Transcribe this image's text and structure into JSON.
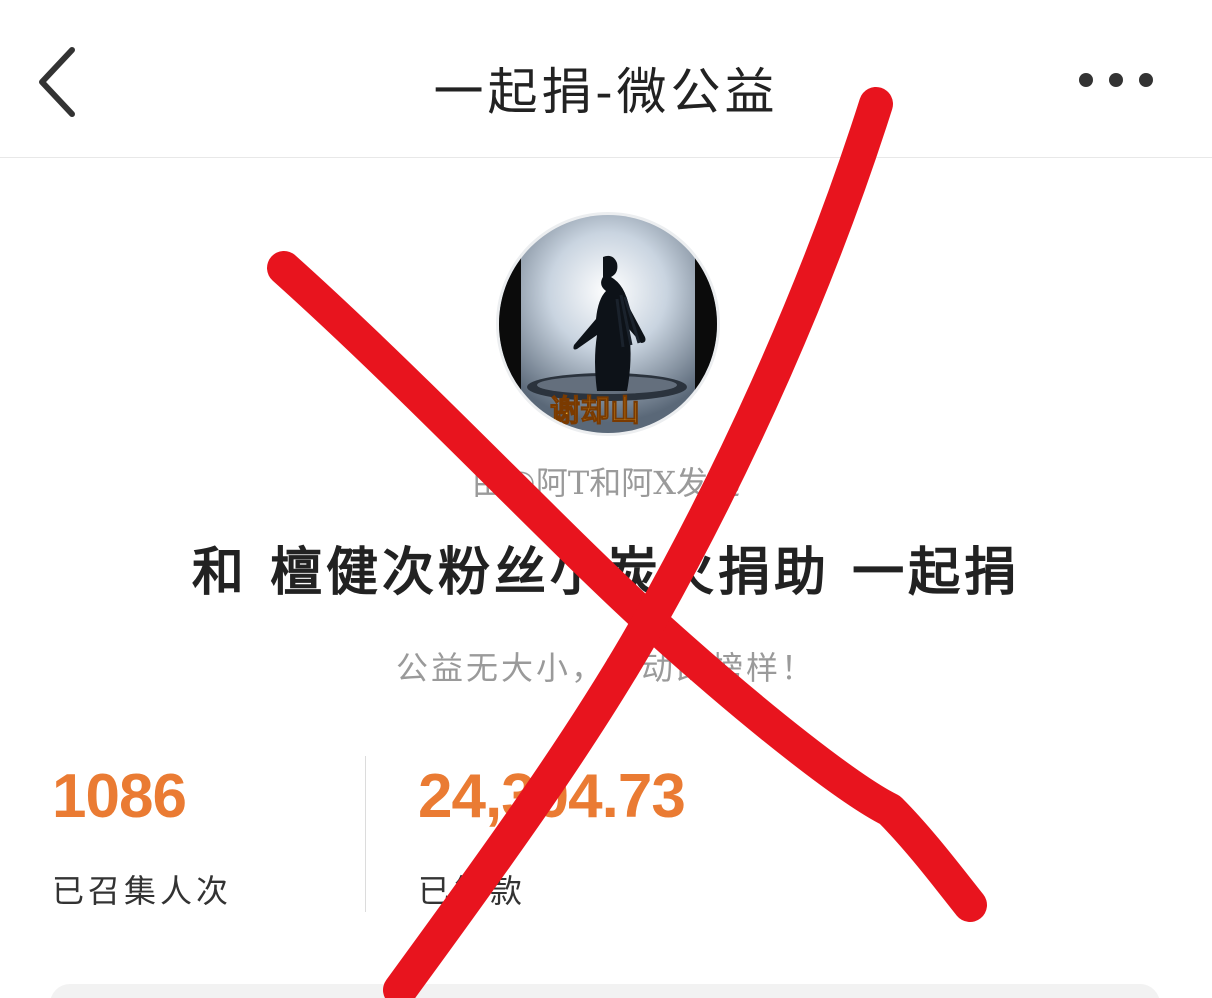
{
  "header": {
    "title": "一起捐-微公益",
    "back_icon": "chevron-left-icon",
    "more_icon": "more-horizontal-icon"
  },
  "campaign": {
    "avatar_caption": "谢却山",
    "initiator": "由@阿T和阿X发起",
    "title": "和 檀健次粉丝小炭火捐助 一起捐",
    "slogan": "公益无大小，行动即榜样！"
  },
  "stats": {
    "participants_value": "1086",
    "participants_label": "已召集人次",
    "raised_value": "24,304.73",
    "raised_label": "已筹款"
  },
  "overlay": {
    "mark": "red-x-cross",
    "color": "#e8141e"
  },
  "colors": {
    "accent": "#ea7b33",
    "text_primary": "#222222",
    "text_secondary": "#9a9a9a"
  }
}
